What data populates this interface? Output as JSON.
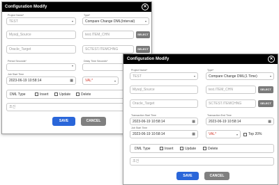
{
  "dialog_back": {
    "title": "Configuration Modify",
    "project_name_label": "Project Name*",
    "project_name_value": "TEST",
    "type_label": "Type*",
    "type_value": "Compare Change DML(Interval)",
    "source_value": "Mysql_Source",
    "source_table_value": "test.ITEM_CHN",
    "target_value": "Oracle_Target",
    "target_table_value": "SCTEST.ITEMCHNG",
    "select_label": "SELECT",
    "period_label": "Period Seconds*",
    "delay_label": "Delay Time Seconds*",
    "job_start_label": "Job Start Time",
    "job_start_value": "2023-06-19 10:58:14",
    "val_value": "VAL*",
    "dml_type_label": "DML Type",
    "insert_label": "Insert",
    "update_label": "Update",
    "delete_label": "Delete",
    "where_value": "조건",
    "save_label": "SAVE",
    "cancel_label": "CANCEL"
  },
  "dialog_front": {
    "title": "Configuration Modify",
    "project_name_label": "Project Name*",
    "project_name_value": "TEST",
    "type_label": "Type*",
    "type_value": "Compare Change DML(1 Time)",
    "source_value": "Mysql_Source",
    "source_table_value": "test.ITEM_CHN",
    "target_value": "Oracle_Target",
    "target_table_value": "SCTEST.ITEMCHNG",
    "select_label": "SELECT",
    "tx_start_label": "Transaction Start Time",
    "tx_start_value": "2023-06-19 10:58:14",
    "tx_end_label": "Transaction End Time",
    "tx_end_value": "2023-06-19 10:58:14",
    "job_start_label": "Job Start Time",
    "job_start_value": "2023-06-19 10:58:14",
    "val_value": "VAL*",
    "top_label": "Top 20%",
    "dml_type_label": "DML Type",
    "insert_label": "Insert",
    "update_label": "Update",
    "delete_label": "Delete",
    "where_value": "조건",
    "save_label": "SAVE",
    "cancel_label": "CANCEL"
  }
}
